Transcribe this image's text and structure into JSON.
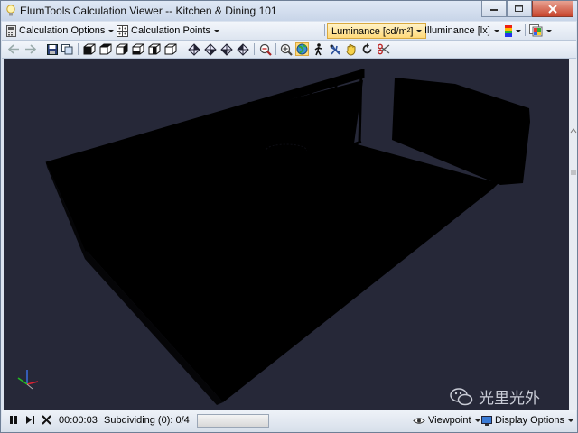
{
  "window": {
    "title": "ElumTools Calculation Viewer -- Kitchen & Dining 101"
  },
  "menubar": {
    "calc_options": "Calculation Options",
    "calc_points": "Calculation Points",
    "luminance": "Luminance [cd/m²]",
    "illuminance": "Illuminance [lx]"
  },
  "toolbar_icons": [
    "back-arrow-icon",
    "forward-arrow-icon",
    "save-icon",
    "copy-icon",
    "view-top-icon",
    "view-front-icon",
    "view-side-icon",
    "view-iso1-icon",
    "view-iso2-icon",
    "view-iso3-icon",
    "orbit-1-icon",
    "orbit-2-icon",
    "orbit-3-icon",
    "orbit-4-icon",
    "zoom-extents-icon",
    "zoom-icon",
    "globe-icon",
    "walk-icon",
    "fly-icon",
    "hand-icon",
    "rotate-icon",
    "cut-icon"
  ],
  "statusbar": {
    "time": "00:00:03",
    "subdividing": "Subdividing (0): 0/4",
    "viewpoint": "Viewpoint",
    "display_options": "Display Options"
  },
  "watermark": {
    "text": "光里光外"
  },
  "colors": {
    "viewport_bg": "#262838",
    "luminance_active": "#ffd97a",
    "titlebar": "#dfe8f5"
  }
}
